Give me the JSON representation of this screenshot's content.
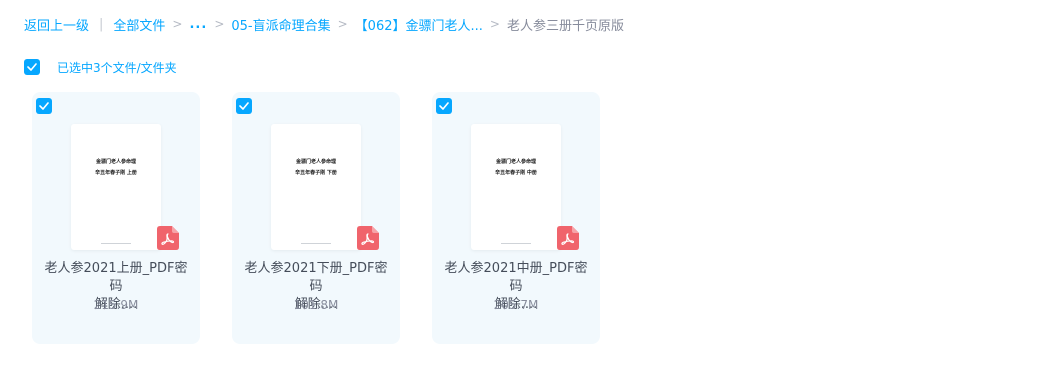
{
  "breadcrumb": {
    "back": "返回上一级",
    "divider": "|",
    "root": "全部文件",
    "separator": ">",
    "ellipsis": "...",
    "folder1": "05-盲派命理合集",
    "folder2": "【062】金骠门老人...",
    "current": "老人参三册千页原版"
  },
  "selection": {
    "label": "已选中3个文件/文件夹",
    "checked": true
  },
  "files": [
    {
      "name_line1": "老人参2021上册_PDF密码",
      "name_line2": "解除....",
      "size": "215.9M",
      "thumb_title": "金骠门老人参命理",
      "thumb_subtitle": "辛丑年春子刚  上册",
      "type_icon": "pdf-icon",
      "checked": true
    },
    {
      "name_line1": "老人参2021下册_PDF密码",
      "name_line2": "解除....",
      "size": "101.8M",
      "thumb_title": "金骠门老人参命理",
      "thumb_subtitle": "辛丑年春子刚  下册",
      "type_icon": "pdf-icon",
      "checked": true
    },
    {
      "name_line1": "老人参2021中册_PDF密码",
      "name_line2": "解除....",
      "size": "205.7M",
      "thumb_title": "金骠门老人参命理",
      "thumb_subtitle": "辛丑年春子刚  中册",
      "type_icon": "pdf-icon",
      "checked": true
    }
  ],
  "colors": {
    "accent": "#06a7ff",
    "card_background": "#f2f9fd",
    "pdf_red": "#f0646c",
    "text_primary": "#454d5a",
    "text_secondary": "#878c9c"
  }
}
